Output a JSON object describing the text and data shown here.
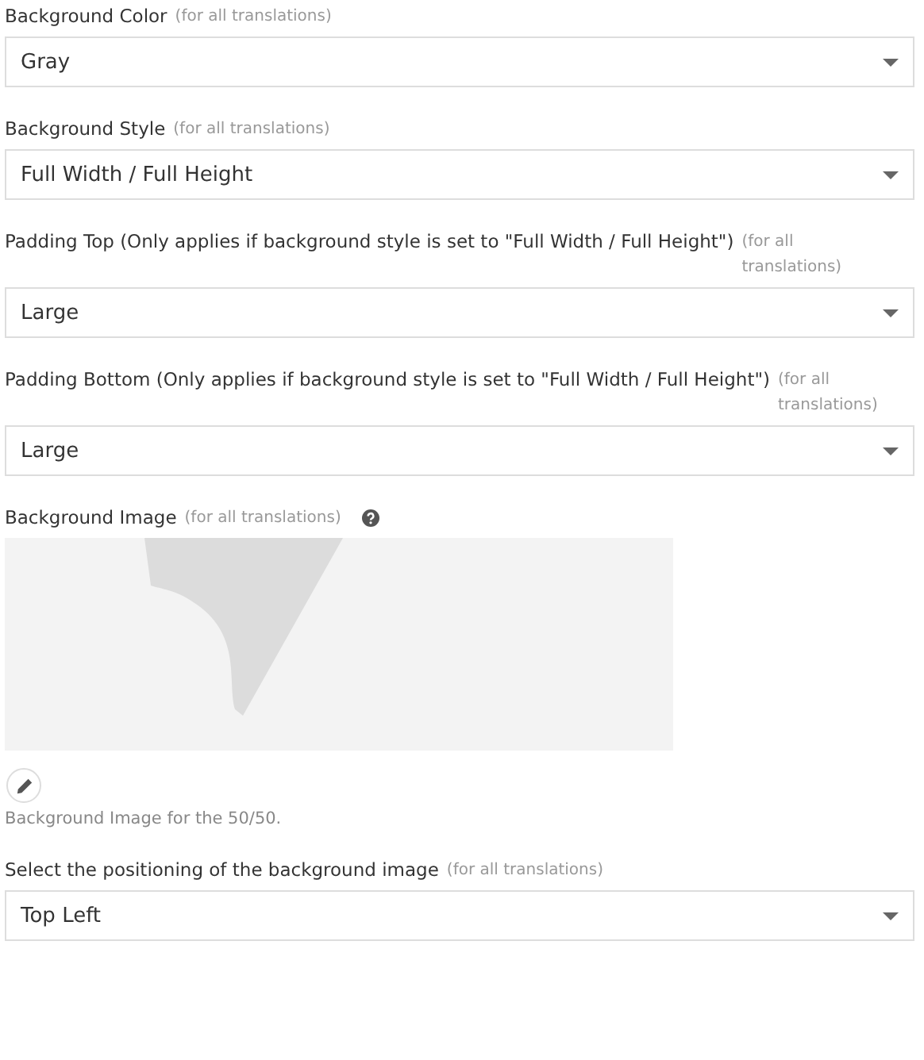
{
  "fields": [
    {
      "kind": "select",
      "label": "Background Color",
      "note": "(for all translations)",
      "value": "Gray"
    },
    {
      "kind": "select",
      "label": "Background Style",
      "note": "(for all translations)",
      "value": "Full Width / Full Height"
    },
    {
      "kind": "select",
      "label": "Padding Top (Only applies if background style is set to \"Full Width / Full Height\")",
      "note": "(for all translations)",
      "value": "Large"
    },
    {
      "kind": "select",
      "label": "Padding Bottom (Only applies if background style is set to \"Full Width / Full Height\")",
      "note": "(for all translations)",
      "value": "Large"
    },
    {
      "label": "Background Image",
      "note": "(for all translations)",
      "description": "Background Image for the 50/50."
    },
    {
      "kind": "select",
      "label": "Select the positioning of the background image",
      "note": "(for all translations)",
      "value": "Top Left"
    }
  ]
}
